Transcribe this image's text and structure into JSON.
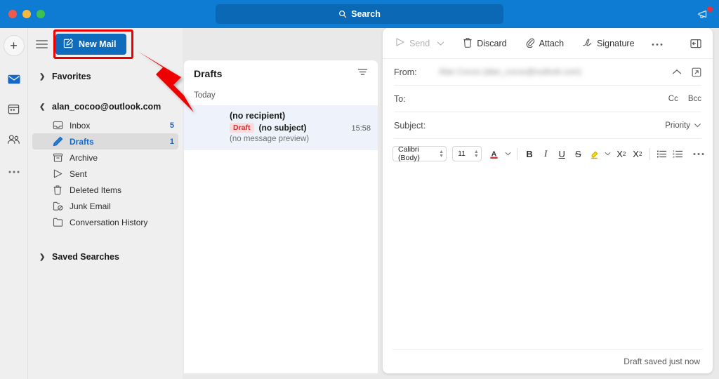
{
  "titlebar": {
    "search_placeholder": "Search",
    "search_icon": "search-icon",
    "notification_icon": "megaphone-icon"
  },
  "rail": {
    "new_item_label": "+",
    "items": [
      {
        "name": "mail",
        "icon": "mail-icon",
        "active": true
      },
      {
        "name": "calendar",
        "icon": "calendar-icon",
        "active": false
      },
      {
        "name": "people",
        "icon": "people-icon",
        "active": false
      },
      {
        "name": "more",
        "icon": "ellipsis-icon",
        "active": false
      }
    ]
  },
  "sidebar": {
    "menu_icon": "hamburger-icon",
    "new_mail_label": "New Mail",
    "new_mail_icon": "compose-icon",
    "favorites_label": "Favorites",
    "account_label": "alan_cocoo@outlook.com",
    "saved_searches_label": "Saved Searches",
    "folders": [
      {
        "label": "Inbox",
        "count": "5",
        "icon": "inbox-icon",
        "selected": false
      },
      {
        "label": "Drafts",
        "count": "1",
        "icon": "pencil-icon",
        "selected": true
      },
      {
        "label": "Archive",
        "count": "",
        "icon": "archive-icon",
        "selected": false
      },
      {
        "label": "Sent",
        "count": "",
        "icon": "send-icon",
        "selected": false
      },
      {
        "label": "Deleted Items",
        "count": "",
        "icon": "trash-icon",
        "selected": false
      },
      {
        "label": "Junk Email",
        "count": "",
        "icon": "junk-icon",
        "selected": false
      },
      {
        "label": "Conversation History",
        "count": "",
        "icon": "folder-icon",
        "selected": false
      }
    ]
  },
  "message_list": {
    "title": "Drafts",
    "filter_icon": "filter-icon",
    "day_group": "Today",
    "messages": [
      {
        "from": "(no recipient)",
        "badge": "Draft",
        "subject": "(no subject)",
        "preview": "(no message preview)",
        "time": "15:58"
      }
    ]
  },
  "compose": {
    "toolbar": {
      "send_label": "Send",
      "send_icon": "send-icon",
      "send_caret_icon": "chevron-down-icon",
      "discard_label": "Discard",
      "discard_icon": "trash-icon",
      "attach_label": "Attach",
      "attach_icon": "paperclip-icon",
      "signature_label": "Signature",
      "signature_icon": "signature-icon",
      "more_label": "…",
      "more_icon": "ellipsis-icon",
      "pane_icon": "reading-pane-icon"
    },
    "fields": {
      "from_label": "From:",
      "from_value": "Alan Cocoo (alan_cocoo@outlook.com)",
      "from_collapse_icon": "chevron-up-icon",
      "from_popout_icon": "popout-icon",
      "to_label": "To:",
      "to_value": "",
      "cc_label": "Cc",
      "bcc_label": "Bcc",
      "subject_label": "Subject:",
      "subject_value": "",
      "priority_label": "Priority",
      "priority_caret_icon": "chevron-down-icon"
    },
    "format": {
      "font_family": "Calibri (Body)",
      "font_size": "11",
      "font_color_icon": "font-color-icon",
      "bold_label": "B",
      "italic_label": "I",
      "underline_label": "U",
      "strike_label": "S",
      "highlight_icon": "highlighter-icon",
      "superscript_label": "X",
      "subscript_label": "X",
      "bullets_icon": "bulleted-list-icon",
      "numbering_icon": "numbered-list-icon",
      "more_icon": "ellipsis-icon"
    },
    "body_value": "",
    "status": "Draft saved just now"
  },
  "annotations": {
    "highlight_target": "new-mail-button",
    "arrow_color": "#ee0000",
    "highlight_color": "#ee0000"
  }
}
